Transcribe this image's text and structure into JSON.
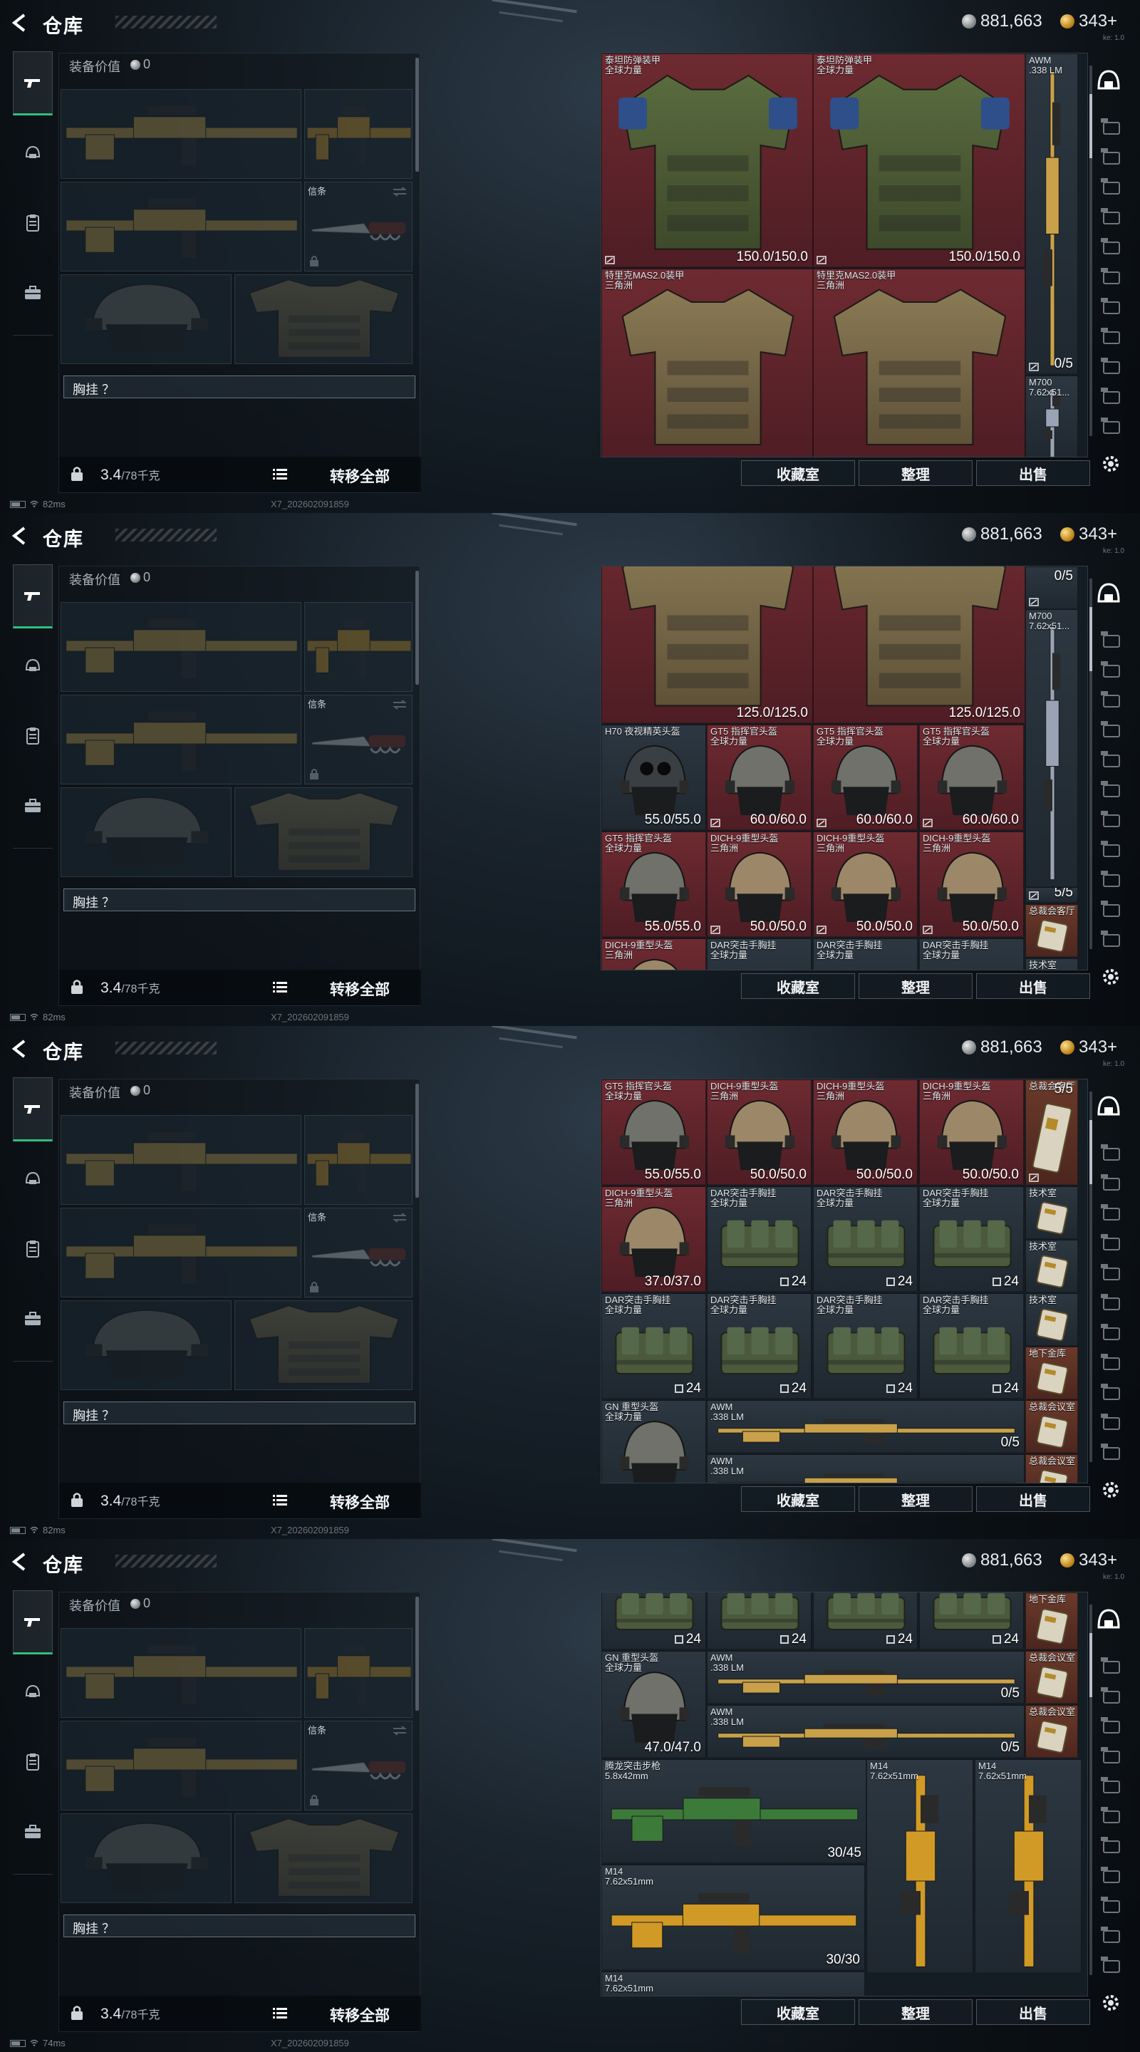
{
  "header": {
    "title": "仓库",
    "silver_amount": "881,663",
    "gold_amount": "343+",
    "corner_text": "ke: 1.0"
  },
  "nav": {
    "items": [
      "weapon-icon",
      "helmet-nav-icon",
      "clipboard-icon",
      "briefcase-icon"
    ]
  },
  "equipment": {
    "value_label": "装备价值",
    "value_amount": "0",
    "melee_slot_name": "信条",
    "chest_rig_label": "胸挂 ？",
    "weight_current": "3.4",
    "weight_max": "/78千克",
    "transfer_all_label": "转移全部"
  },
  "status": {
    "ping_values": [
      "82ms",
      "82ms",
      "82ms",
      "74ms"
    ],
    "build_id": "X7_202602091859"
  },
  "buttons": {
    "vault": "收藏室",
    "organize": "整理",
    "sell": "出售"
  },
  "screens": [
    {
      "items": [
        {
          "name": "泰坦防弹装甲\n全球力量",
          "value": "150.0/150.0"
        },
        {
          "name": "泰坦防弹装甲\n全球力量",
          "value": "150.0/150.0"
        },
        {
          "name": "AWM\n.338 LM",
          "value": "0/5"
        },
        {
          "name": "特里克MAS2.0装甲\n三角洲",
          "value": ""
        },
        {
          "name": "特里克MAS2.0装甲\n三角洲",
          "value": ""
        },
        {
          "name": "M700\n7.62x51...",
          "value": ""
        }
      ]
    },
    {
      "items": [
        {
          "name": "",
          "value": "125.0/125.0"
        },
        {
          "name": "",
          "value": "125.0/125.0"
        },
        {
          "name": "",
          "value": "0/5"
        },
        {
          "name": "M700\n7.62x51...",
          "value": ""
        },
        {
          "name": "H70 夜视精英头盔",
          "value": "55.0/55.0"
        },
        {
          "name": "GT5 指挥官头盔\n全球力量",
          "value": "60.0/60.0"
        },
        {
          "name": "GT5 指挥官头盔\n全球力量",
          "value": "60.0/60.0"
        },
        {
          "name": "GT5 指挥官头盔\n全球力量",
          "value": "60.0/60.0"
        },
        {
          "name": "",
          "value": "5/5"
        },
        {
          "name": "GT5 指挥官头盔\n全球力量",
          "value": "55.0/55.0"
        },
        {
          "name": "DICH-9重型头盔\n三角洲",
          "value": "50.0/50.0"
        },
        {
          "name": "DICH-9重型头盔\n三角洲",
          "value": "50.0/50.0"
        },
        {
          "name": "DICH-9重型头盔\n三角洲",
          "value": "50.0/50.0"
        },
        {
          "name": "总裁会客厅",
          "value": ""
        },
        {
          "name": "DICH-9重型头盔\n三角洲",
          "value": ""
        },
        {
          "name": "DAR突击手胸挂\n全球力量",
          "value": ""
        },
        {
          "name": "DAR突击手胸挂\n全球力量",
          "value": ""
        },
        {
          "name": "DAR突击手胸挂\n全球力量",
          "value": ""
        },
        {
          "name": "技术室",
          "value": ""
        }
      ]
    },
    {
      "items": [
        {
          "name": "GT5 指挥官头盔\n全球力量",
          "value": "55.0/55.0"
        },
        {
          "name": "DICH-9重型头盔\n三角洲",
          "value": "50.0/50.0"
        },
        {
          "name": "DICH-9重型头盔\n三角洲",
          "value": "50.0/50.0"
        },
        {
          "name": "DICH-9重型头盔\n三角洲",
          "value": "50.0/50.0"
        },
        {
          "name": "总裁会客厅",
          "value": "5/5"
        },
        {
          "name": "DICH-9重型头盔\n三角洲",
          "value": "37.0/37.0"
        },
        {
          "name": "DAR突击手胸挂\n全球力量",
          "value": "24"
        },
        {
          "name": "DAR突击手胸挂\n全球力量",
          "value": "24"
        },
        {
          "name": "DAR突击手胸挂\n全球力量",
          "value": "24"
        },
        {
          "name": "技术室",
          "value": ""
        },
        {
          "name": "技术室",
          "value": ""
        },
        {
          "name": "DAR突击手胸挂\n全球力量",
          "value": "24"
        },
        {
          "name": "DAR突击手胸挂\n全球力量",
          "value": "24"
        },
        {
          "name": "DAR突击手胸挂\n全球力量",
          "value": "24"
        },
        {
          "name": "DAR突击手胸挂\n全球力量",
          "value": "24"
        },
        {
          "name": "技术室",
          "value": ""
        },
        {
          "name": "地下金库",
          "value": ""
        },
        {
          "name": "GN 重型头盔\n全球力量",
          "value": ""
        },
        {
          "name": "AWM\n.338 LM",
          "value": "0/5"
        },
        {
          "name": "总裁会议室",
          "value": ""
        },
        {
          "name": "AWM\n.338 LM",
          "value": ""
        },
        {
          "name": "总裁会议室",
          "value": ""
        }
      ]
    },
    {
      "items": [
        {
          "name": "",
          "value": "24"
        },
        {
          "name": "",
          "value": "24"
        },
        {
          "name": "",
          "value": "24"
        },
        {
          "name": "",
          "value": "24"
        },
        {
          "name": "地下金库",
          "value": ""
        },
        {
          "name": "GN 重型头盔\n全球力量",
          "value": "47.0/47.0"
        },
        {
          "name": "AWM\n.338 LM",
          "value": "0/5"
        },
        {
          "name": "总裁会议室",
          "value": ""
        },
        {
          "name": "AWM\n.338 LM",
          "value": "0/5"
        },
        {
          "name": "总裁会议室",
          "value": ""
        },
        {
          "name": "腾龙突击步枪\n5.8x42mm",
          "value": "30/45"
        },
        {
          "name": "M14\n7.62x51mm",
          "value": ""
        },
        {
          "name": "M14\n7.62x51mm",
          "value": ""
        },
        {
          "name": "M14\n7.62x51mm",
          "value": "30/30"
        },
        {
          "name": "M14\n7.62x51mm",
          "value": ""
        }
      ]
    }
  ]
}
